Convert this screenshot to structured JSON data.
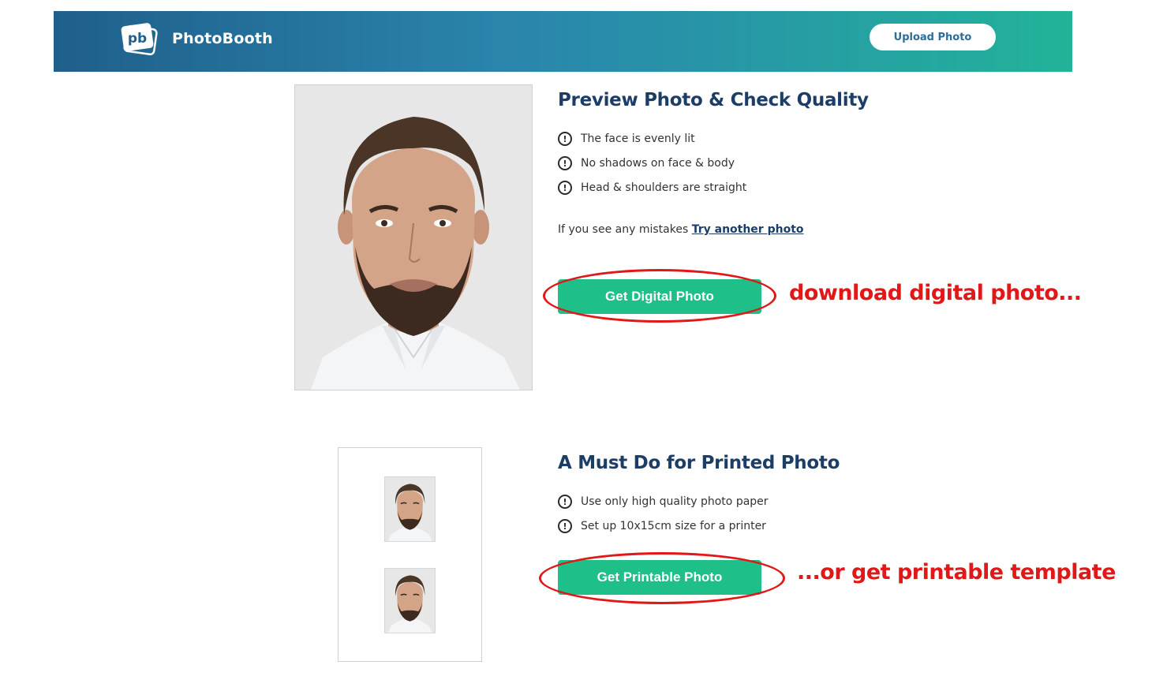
{
  "header": {
    "brand": "PhotoBooth",
    "logo_text": "pb",
    "upload_label": "Upload Photo"
  },
  "preview": {
    "title": "Preview Photo & Check Quality",
    "checks": [
      "The face is evenly lit",
      "No shadows on face & body",
      "Head & shoulders are straight"
    ],
    "mistake_prefix": "If you see any mistakes",
    "try_another": "Try another photo",
    "digital_button": "Get Digital Photo"
  },
  "printed": {
    "title": "A Must Do for Printed Photo",
    "checks": [
      "Use only high quality photo paper",
      "Set up 10x15cm size for a printer"
    ],
    "printable_button": "Get Printable Photo"
  },
  "annotations": {
    "digital": "download digital photo...",
    "printable": "...or get printable template"
  },
  "icons": {
    "check": "exclamation-circle-icon",
    "logo": "photobooth-logo-icon"
  },
  "colors": {
    "accent_green": "#1fbf8a",
    "heading_navy": "#1c3d66",
    "annotation_red": "#e01818",
    "header_start": "#1f5f8b",
    "header_end": "#22b39a"
  }
}
